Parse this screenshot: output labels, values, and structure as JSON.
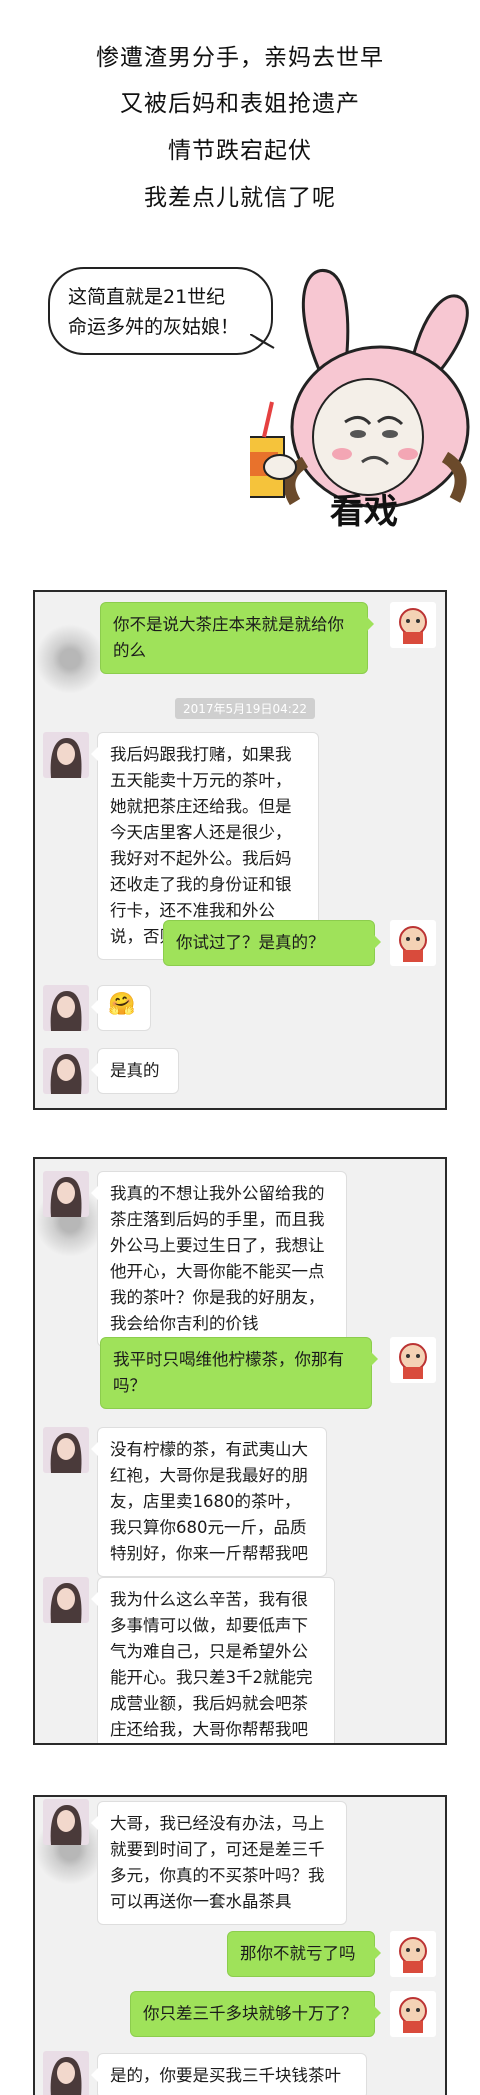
{
  "header": {
    "lines": [
      "惨遭渣男分手，亲妈去世早",
      "又被后妈和表姐抢遗产",
      "情节跌宕起伏",
      "我差点儿就信了呢"
    ]
  },
  "sticker": {
    "bubble_line1": "这简直就是21世纪",
    "bubble_line2": "命运多舛的灰姑娘！",
    "caption": "看戏"
  },
  "panel1": {
    "msg1": "你不是说大茶庄本来就是就给你的么",
    "timestamp": "2017年5月19日04:22",
    "msg2": "我后妈跟我打赌，如果我五天能卖十万元的茶叶，她就把茶庄还给我。但是今天店里客人还是很少，我好对不起外公。我后妈还收走了我的身份证和银行卡，还不准我和外公说，否则就算我输",
    "msg3": "你试过了？是真的？",
    "msg4_emoji": "🤗",
    "msg5": "是真的"
  },
  "panel2": {
    "msg1": "我真的不想让我外公留给我的茶庄落到后妈的手里，而且我外公马上要过生日了，我想让他开心，大哥你能不能买一点我的茶叶？你是我的好朋友，我会给你吉利的价钱",
    "msg2": "我平时只喝维他柠檬茶，你那有吗？",
    "msg3": "没有柠檬的茶，有武夷山大红袍，大哥你是我最好的朋友，店里卖1680的茶叶，我只算你680元一斤，品质特别好，你来一斤帮帮我吧",
    "msg4": "我为什么这么辛苦，我有很多事情可以做，却要低声下气为难自己，只是希望外公能开心。我只差3千2就能完成营业额，我后妈就会吧茶庄还给我，大哥你帮帮我吧"
  },
  "panel3": {
    "msg1": "大哥，我已经没有办法，马上就要到时间了，可还是差三千多元，你真的不买茶叶吗？我可以再送你一套水晶茶具",
    "msg2": "那你不就亏了吗",
    "msg3": "你只差三千多块就够十万了？",
    "msg4": "是的，你要是买我三千块钱茶叶"
  }
}
